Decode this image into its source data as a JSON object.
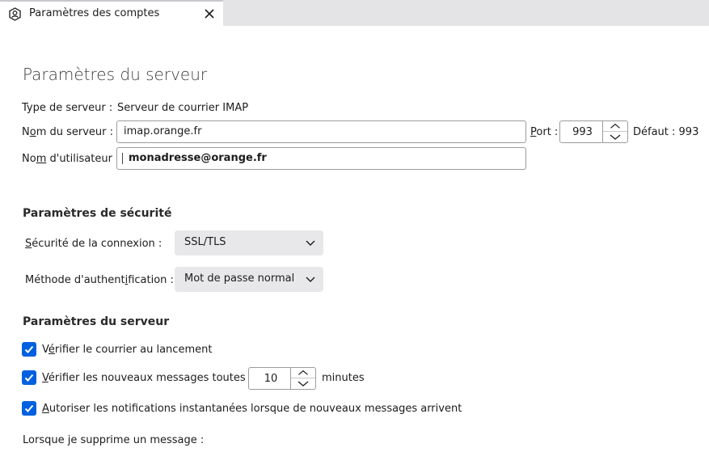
{
  "tab": {
    "title": "Paramètres des comptes",
    "icon": "account-settings-icon",
    "close_icon": "close-icon"
  },
  "page_title": "Paramètres du serveur",
  "server": {
    "type_label": "Type de serveur :",
    "type_value": "Serveur de courrier IMAP",
    "name_label_prefix": "N",
    "name_label_accel": "o",
    "name_label_rest": "m du serveur :",
    "name_value": "imap.orange.fr",
    "port_label_accel": "P",
    "port_label_rest": "ort :",
    "port_value": "993",
    "default_text": "Défaut : 993",
    "username_label_prefix": "No",
    "username_label_accel": "m",
    "username_label_rest": " d'utilisateur :",
    "username_value": "monadresse@orange.fr"
  },
  "security": {
    "title": "Paramètres de sécurité",
    "connection_label_accel": "S",
    "connection_label_rest": "écurité de la connexion :",
    "connection_value": "SSL/TLS",
    "auth_label_prefix": "Méthode d'authent",
    "auth_label_accel": "i",
    "auth_label_rest": "fication :",
    "auth_value": "Mot de passe normal"
  },
  "server_settings": {
    "title": "Paramètres du serveur",
    "check_startup_prefix": "V",
    "check_startup_accel": "é",
    "check_startup_rest": "rifier le courrier au lancement",
    "check_startup_checked": true,
    "check_every_accel": "V",
    "check_every_rest": "érifier les nouveaux messages toutes les",
    "check_every_checked": true,
    "check_every_minutes": "10",
    "minutes_label": "minutes",
    "notifications_accel": "A",
    "notifications_rest": "utoriser les notifications instantanées lorsque de nouveaux messages arrivent",
    "notifications_checked": true,
    "delete_label": "Lorsque je supprime un message :"
  },
  "colors": {
    "accent": "#0060df",
    "tabbar": "#e4e4e6",
    "select_bg": "#e8e8ea"
  }
}
